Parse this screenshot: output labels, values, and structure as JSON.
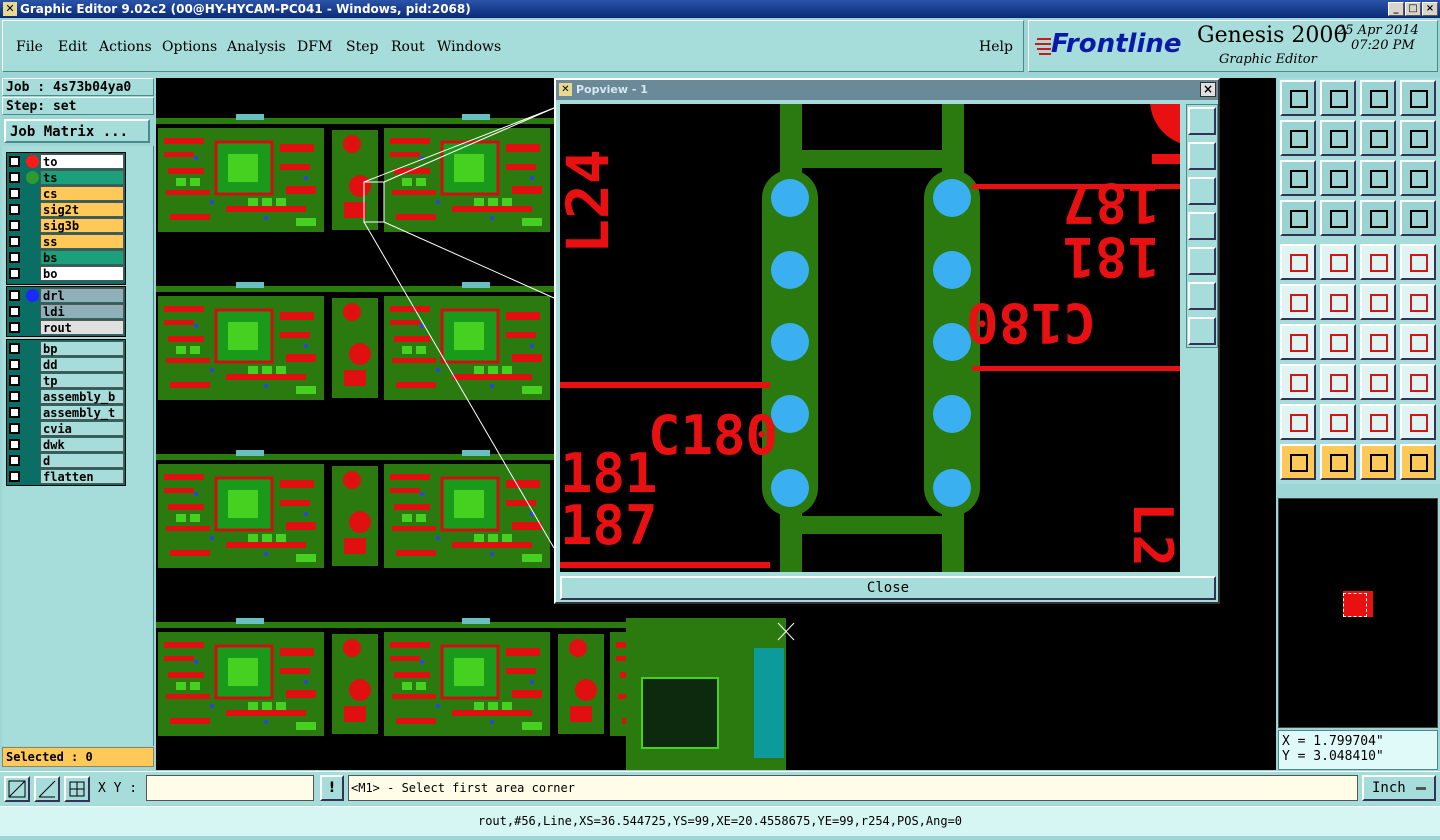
{
  "window": {
    "title": "Graphic Editor 9.02c2 (00@HY-HYCAM-PC041 - Windows, pid:2068)"
  },
  "menus": [
    "File",
    "Edit",
    "Actions",
    "Options",
    "Analysis",
    "DFM",
    "Step",
    "Rout",
    "Windows"
  ],
  "help_label": "Help",
  "brand": {
    "logo": "Frontline",
    "product": "Genesis 2000",
    "subtitle": "Graphic Editor",
    "date": "25 Apr 2014",
    "time": "07:20 PM"
  },
  "job": {
    "job_label": "Job : 4s73b04ya0",
    "step_label": "Step: set",
    "matrix_button": "Job Matrix ..."
  },
  "layers_board": [
    {
      "name": "to",
      "color": "#ffffff",
      "dot": "#ff1a1a"
    },
    {
      "name": "ts",
      "color": "#1aa07a",
      "dot": "#2e9a2e"
    },
    {
      "name": "cs",
      "color": "#ffc95a",
      "dot": ""
    },
    {
      "name": "sig2t",
      "color": "#ffc95a",
      "dot": ""
    },
    {
      "name": "sig3b",
      "color": "#ffc95a",
      "dot": ""
    },
    {
      "name": "ss",
      "color": "#ffc95a",
      "dot": ""
    },
    {
      "name": "bs",
      "color": "#1aa07a",
      "dot": ""
    },
    {
      "name": "bo",
      "color": "#ffffff",
      "dot": ""
    }
  ],
  "layers_drill": [
    {
      "name": "drl",
      "color": "#8fb0b8",
      "dot": "#1a2aff"
    },
    {
      "name": "ldi",
      "color": "#8fb0b8",
      "dot": ""
    },
    {
      "name": "rout",
      "color": "#e0e0e0",
      "dot": ""
    }
  ],
  "layers_misc": [
    "bp",
    "dd",
    "tp",
    "assembly_b",
    "assembly_t",
    "cvia",
    "dwk",
    "d",
    "flatten"
  ],
  "selected": "Selected : 0",
  "xy_label": "X Y :",
  "xy_input": "",
  "prompt": "<M1> - Select first area corner",
  "units": "Inch",
  "status": "rout,#56,Line,XS=36.544725,YS=99,XE=20.4558675,YE=99,r254,POS,Ang=0",
  "coords": {
    "x": "X = 1.799704\"",
    "y": "Y = 3.048410\""
  },
  "popview": {
    "title": "Popview - 1",
    "close_label": "Close",
    "silk_labels": [
      "L24",
      "C180",
      "181",
      "187",
      "C180",
      "181",
      "187",
      "L2"
    ]
  }
}
